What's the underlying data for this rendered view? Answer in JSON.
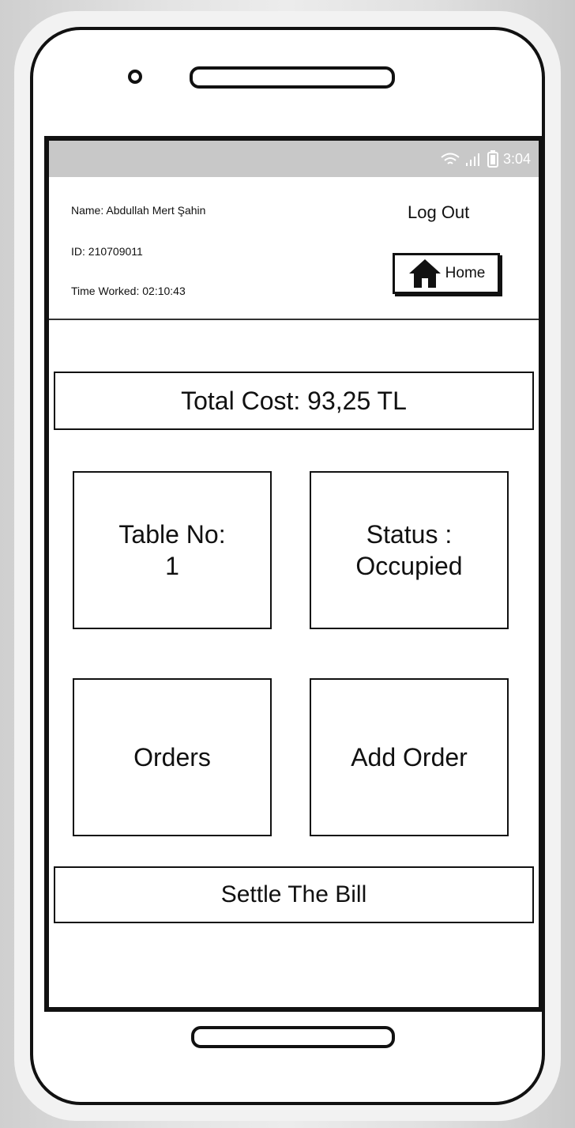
{
  "statusbar": {
    "time": "3:04",
    "icons": [
      "wifi-icon",
      "signal-icon",
      "battery-icon"
    ]
  },
  "header": {
    "name": "Name: Abdullah Mert Şahin",
    "id": "ID: 210709011",
    "time_worked": "Time Worked: 02:10:43",
    "logout_label": "Log Out",
    "home_label": "Home",
    "home_icon": "home-icon"
  },
  "main": {
    "total_cost": "Total Cost: 93,25 TL",
    "table_label": "Table No:",
    "table_value": "1",
    "status_label": "Status :",
    "status_value": "Occupied",
    "orders_label": "Orders",
    "add_order_label": "Add Order",
    "settle_label": "Settle The Bill"
  }
}
